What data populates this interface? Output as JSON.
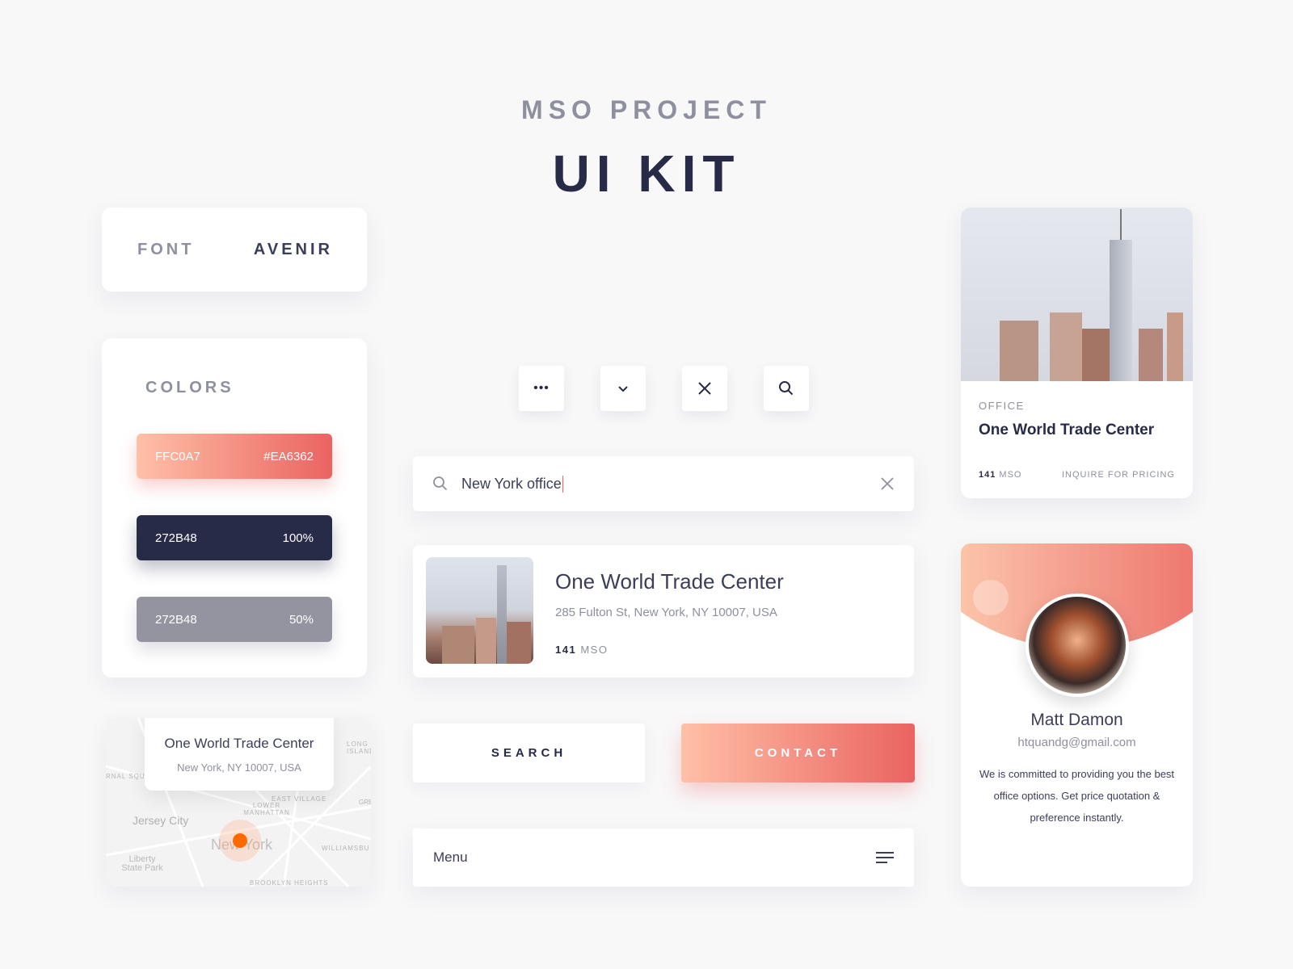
{
  "header": {
    "subtitle": "MSO PROJECT",
    "title": "UI KIT"
  },
  "font_card": {
    "label": "FONT",
    "value": "AVENIR"
  },
  "colors": {
    "label": "COLORS",
    "swatches": [
      {
        "left": "FFC0A7",
        "right": "#EA6362",
        "from": "#FFC0A7",
        "to": "#EA6362"
      },
      {
        "left": "272B48",
        "right": "100%",
        "from": "#272B48",
        "to": "#272B48"
      },
      {
        "left": "272B48",
        "right": "50%",
        "from": "#93949F",
        "to": "#93949F"
      }
    ]
  },
  "icon_buttons": [
    "more-icon",
    "chevron-down-icon",
    "close-icon",
    "search-icon"
  ],
  "search": {
    "value": "New York office"
  },
  "result": {
    "title": "One World Trade Center",
    "address": "285 Fulton St, New York, NY 10007, USA",
    "count": "141",
    "unit": "MSO"
  },
  "buttons": {
    "search": "SEARCH",
    "contact": "CONTACT"
  },
  "menu": {
    "label": "Menu"
  },
  "map": {
    "title": "One World Trade Center",
    "address": "New York, NY 10007, USA",
    "labels": [
      "Jersey City",
      "New York",
      "LOWER MANHATTAN",
      "EAST VILLAGE",
      "WILLIAMSBU",
      "Liberty State Park",
      "BROOKLYN HEIGHTS",
      "LONG ISLAND",
      "RNAL SQUA",
      "GRE"
    ]
  },
  "office_card": {
    "category": "OFFICE",
    "title": "One World Trade Center",
    "count": "141",
    "unit": "MSO",
    "cta": "INQUIRE FOR PRICING"
  },
  "profile": {
    "name": "Matt Damon",
    "email": "htquandg@gmail.com",
    "bio": "We is committed to providing you the best office options. Get price quotation & preference instantly."
  },
  "accent": {
    "orange": "#FF6A00",
    "dark": "#272B48",
    "gray": "#8E909F"
  }
}
